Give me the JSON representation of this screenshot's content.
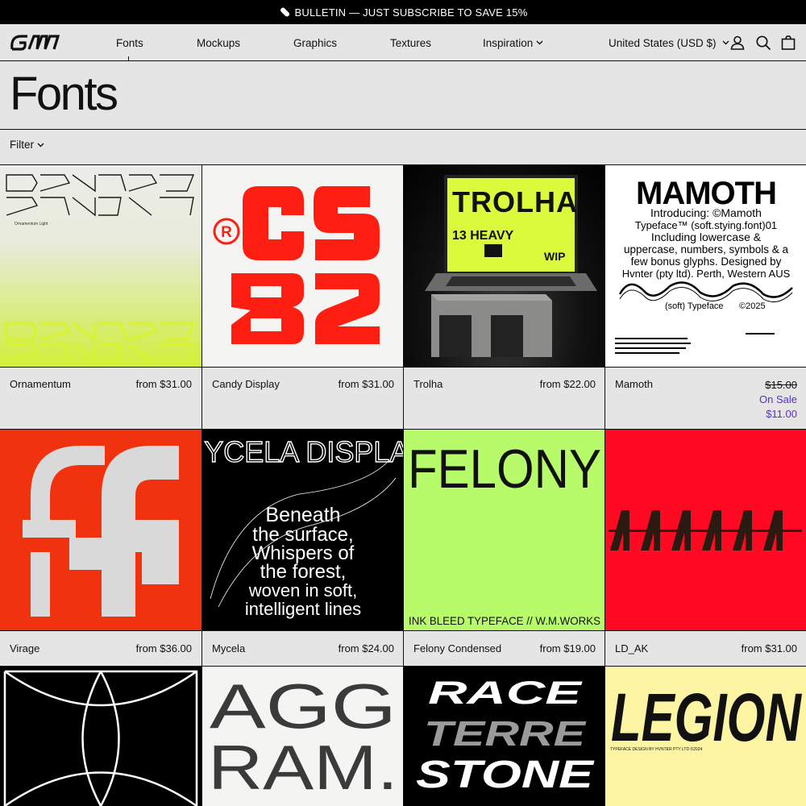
{
  "announcement": {
    "text": "BULLETIN — JUST SUBSCRIBE TO SAVE 15%",
    "icon": "pill-icon"
  },
  "header": {
    "logo_text": "GM",
    "nav": [
      {
        "label": "Fonts",
        "active": true
      },
      {
        "label": "Mockups"
      },
      {
        "label": "Graphics"
      },
      {
        "label": "Textures"
      },
      {
        "label": "Inspiration",
        "has_dropdown": true
      }
    ],
    "currency": "United States (USD $)",
    "icons": [
      "account-icon",
      "search-icon",
      "cart-icon"
    ]
  },
  "page": {
    "title": "Fonts",
    "filter_label": "Filter"
  },
  "products": [
    {
      "name": "Ornamentum",
      "price": "from $31.00",
      "thumb_caption": "Ornamentum Light"
    },
    {
      "name": "Candy Display",
      "price": "from $31.00",
      "thumb_art": "CS 82"
    },
    {
      "name": "Trolha",
      "price": "from $22.00",
      "thumb_art": "TROLHA",
      "thumb_lines": [
        "13 HEAVY",
        "WIP"
      ]
    },
    {
      "name": "Mamoth",
      "original_price": "$15.00",
      "sale_label": "On Sale",
      "price": "$11.00",
      "thumb_art": "MAMOTH",
      "thumb_lines": [
        "Introducing: ©Mamoth",
        "Typeface™ (soft.stying.font)01",
        "Including lowercase &",
        "uppercase, numbers, symbols & a",
        "few bonus glyphs. Designed by",
        "Hvnter (pty ltd). Perth, Western AUS"
      ],
      "thumb_footer": [
        "(soft) Typeface",
        "©2025"
      ]
    },
    {
      "name": "Virage",
      "price": "from $36.00",
      "thumb_art": "ff"
    },
    {
      "name": "Mycela",
      "price": "from $24.00",
      "thumb_art": "MYCELA DISPLAY",
      "thumb_lines": [
        "Beneath",
        "the surface,",
        "Whispers of",
        "the forest,",
        "woven in soft,",
        "intelligent lines"
      ]
    },
    {
      "name": "Felony Condensed",
      "price": "from $19.00",
      "thumb_art": "FELONY",
      "thumb_caption": "INK BLEED TYPEFACE // W.M.WORKS"
    },
    {
      "name": "LD_AK",
      "price": "from $31.00",
      "thumb_art": "AAAAAA"
    },
    {
      "name": "",
      "price": ""
    },
    {
      "name": "",
      "price": "",
      "thumb_art": "AGG RAM."
    },
    {
      "name": "",
      "price": "",
      "thumb_art": "RACE TERRE STONE"
    },
    {
      "name": "",
      "price": "",
      "thumb_art": "LEGION",
      "thumb_caption": "TYPEFACE DESIGN BY HVNTER PTY LTD ©2024"
    }
  ],
  "colors": {
    "background": "#e5e5e5",
    "ink": "#111111",
    "sale": "#5b2bd8",
    "lime": "#d6f23a",
    "red": "#ff1f12",
    "green": "#b8fb6a"
  }
}
